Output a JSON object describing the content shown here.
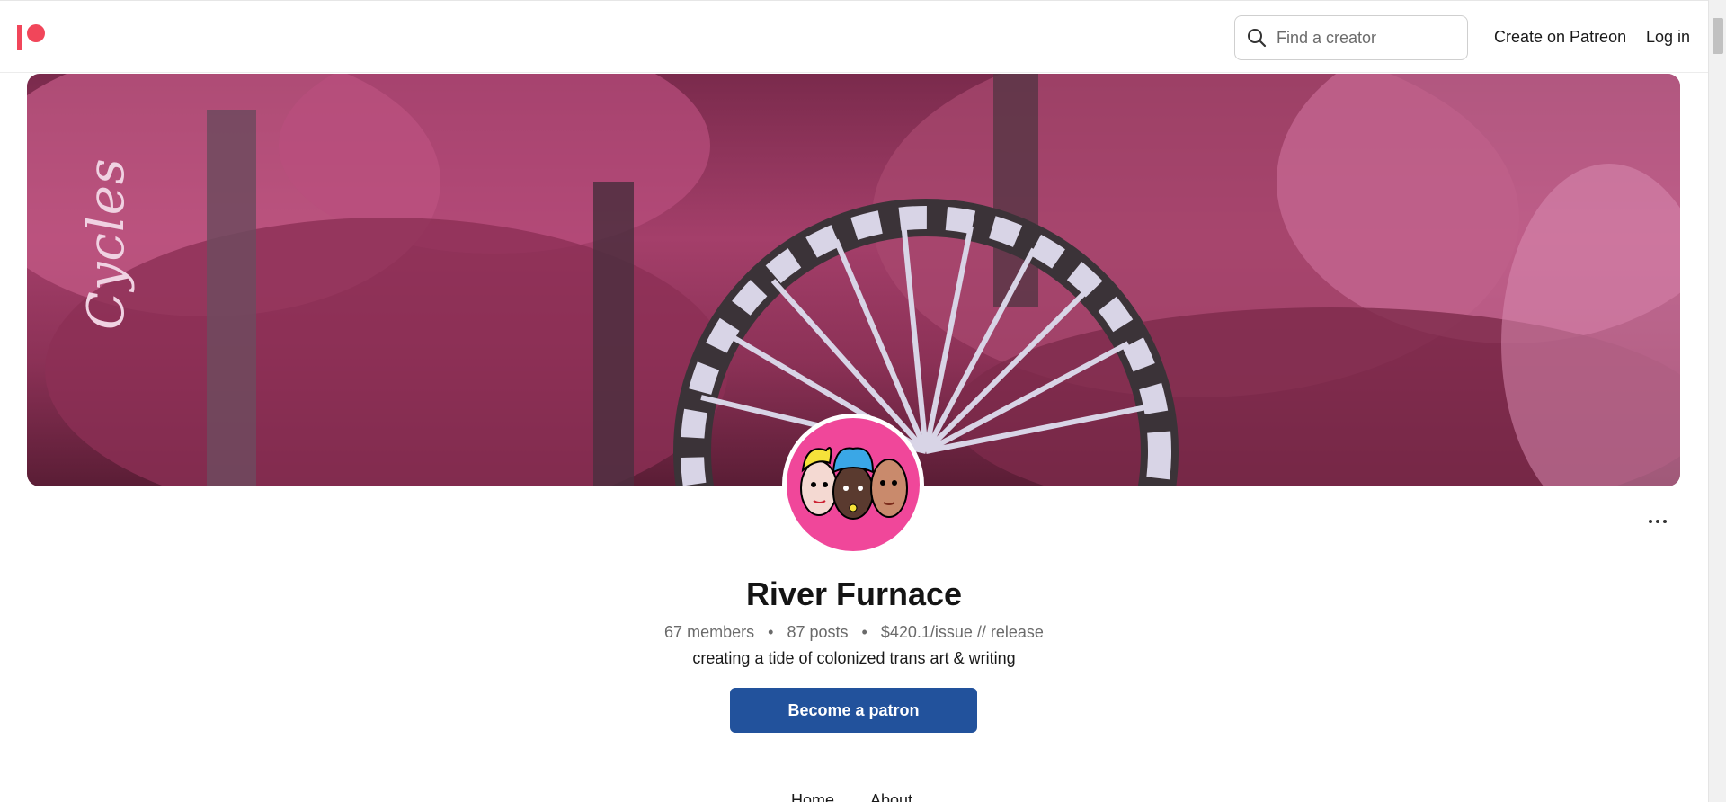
{
  "header": {
    "logo": "patreon-logo",
    "search": {
      "placeholder": "Find a creator",
      "value": ""
    },
    "create_label": "Create on Patreon",
    "login_label": "Log in"
  },
  "banner": {
    "overlay_text": "Cycles"
  },
  "profile": {
    "name": "River Furnace",
    "members": "67 members",
    "posts": "87 posts",
    "price": "$420.1/issue // release",
    "separator": "•",
    "tagline": "creating a tide of colonized trans art & writing",
    "cta_label": "Become a patron"
  },
  "tabs": [
    {
      "label": "Home"
    },
    {
      "label": "About"
    }
  ],
  "colors": {
    "brand": "#f1465a",
    "cta": "#22529c",
    "avatar_bg": "#f0479a"
  }
}
